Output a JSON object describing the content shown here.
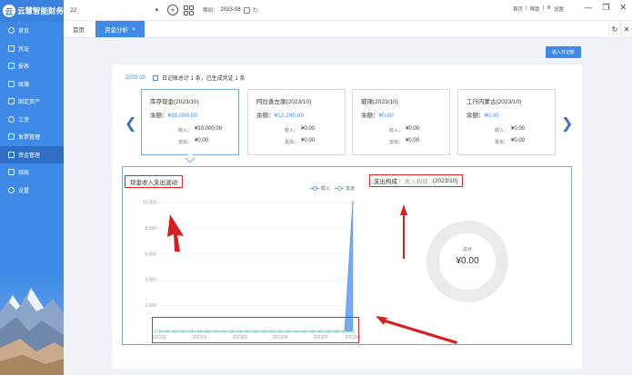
{
  "app": {
    "name": "云慧智能财务"
  },
  "sidebar": {
    "items": [
      {
        "label": "首页"
      },
      {
        "label": "凭证"
      },
      {
        "label": "报表"
      },
      {
        "label": "账簿"
      },
      {
        "label": "固定资产"
      },
      {
        "label": "工资"
      },
      {
        "label": "发票管理"
      },
      {
        "label": "资金管理"
      },
      {
        "label": "结账"
      },
      {
        "label": "设置"
      }
    ]
  },
  "topbar": {
    "account": "22",
    "period_label": "期间：",
    "period_value": "2023-08",
    "links": [
      "首页",
      "|",
      "帮助",
      "|",
      "设置"
    ]
  },
  "tabs": [
    {
      "label": "首页"
    },
    {
      "label": "资金分析"
    }
  ],
  "actions": {
    "diary_button": "进入日记账"
  },
  "summary": {
    "month": "2023-10",
    "text": "日记账总计 1 条，已生成凭证 1 条"
  },
  "cards": [
    {
      "name": "库存现金(2023/10)",
      "balance_label": "余额：",
      "balance": "¥30,000.00",
      "income_label": "收入：",
      "income": "¥10,000.00",
      "expense_label": "支出：",
      "expense": "¥0.00"
    },
    {
      "name": "阿拉善左旗(2023/10)",
      "balance_label": "余额：",
      "balance": "¥12,245.00",
      "income_label": "收入：",
      "income": "¥0.00",
      "expense_label": "支出：",
      "expense": "¥0.00"
    },
    {
      "name": "玻璃(2023/10)",
      "balance_label": "余额：",
      "balance": "¥0.00",
      "income_label": "收入：",
      "income": "¥0.00",
      "expense_label": "支出：",
      "expense": "¥0.00"
    },
    {
      "name": "工行内蒙古(2023/10)",
      "balance_label": "余额：",
      "balance": "¥0.00",
      "income_label": "收入：",
      "income": "¥0.00",
      "expense_label": "支出：",
      "expense": "¥0.00"
    }
  ],
  "charts": {
    "left_title": "现金收入支出波动",
    "right_title": "支出构成",
    "right_sep": "|",
    "right_alt": "收入构成",
    "right_period": "(2023/10)",
    "donut_title": "总计",
    "donut_value": "¥0.00"
  },
  "chart_data": [
    {
      "type": "area",
      "series": [
        {
          "name": "收入",
          "color": "#5b9bf0",
          "values": [
            0,
            0,
            0,
            0,
            0,
            0,
            0,
            0,
            0,
            0,
            0,
            0,
            0,
            0,
            0,
            0,
            0,
            0,
            0,
            0,
            0,
            0,
            0,
            0,
            10000
          ]
        },
        {
          "name": "支出",
          "color": "#4cc7a0",
          "values": [
            0,
            0,
            0,
            0,
            0,
            0,
            0,
            0,
            0,
            0,
            0,
            0,
            0,
            0,
            0,
            0,
            0,
            0,
            0,
            0,
            0,
            0,
            0,
            0,
            0
          ]
        }
      ],
      "x": [
        "202211",
        "",
        "",
        "",
        "",
        "202301",
        "",
        "",
        "",
        "",
        "202303",
        "",
        "",
        "",
        "",
        "202305",
        "",
        "",
        "",
        "",
        "202307",
        "",
        "",
        "",
        "202309"
      ],
      "y_ticks": [
        "0",
        "2,000",
        "4,000",
        "6,000",
        "8,000",
        "10,000"
      ],
      "ylim": [
        0,
        10000
      ],
      "legend": "top-right",
      "grid": true
    },
    {
      "type": "pie",
      "categories": [],
      "values": [],
      "color": "#ebebeb"
    }
  ]
}
